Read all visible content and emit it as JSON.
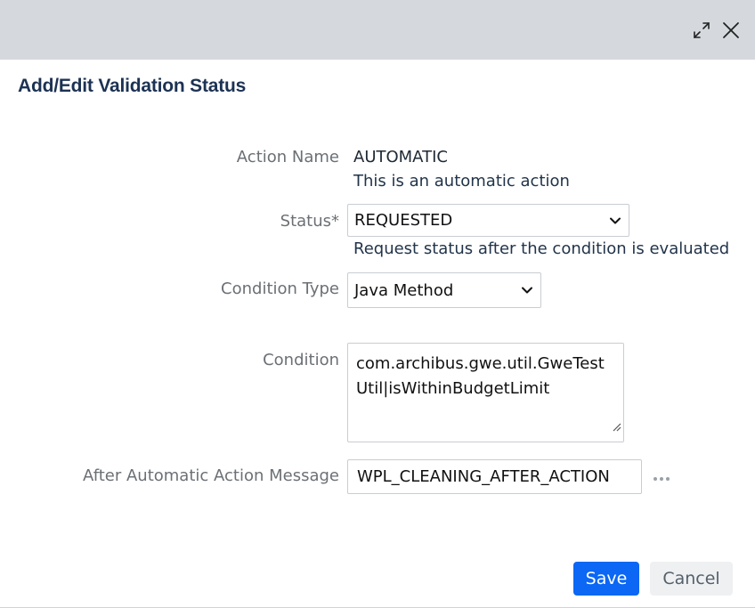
{
  "dialog": {
    "title": "Add/Edit Validation Status"
  },
  "form": {
    "action_name": {
      "label": "Action Name",
      "value": "AUTOMATIC",
      "description": "This is an automatic action"
    },
    "status": {
      "label": "Status*",
      "value": "REQUESTED",
      "hint": "Request status after the condition is evaluated"
    },
    "condition_type": {
      "label": "Condition Type",
      "value": "Java Method"
    },
    "condition": {
      "label": "Condition",
      "value": "com.archibus.gwe.util.GweTestUtil|isWithinBudgetLimit"
    },
    "after_message": {
      "label": "After Automatic Action Message",
      "value": "WPL_CLEANING_AFTER_ACTION"
    }
  },
  "buttons": {
    "save": "Save",
    "cancel": "Cancel"
  },
  "colors": {
    "titlebar_bg": "#d5d9dd",
    "primary": "#0b67f4",
    "title_text": "#1c3253"
  },
  "icons": {
    "expand": "expand-icon",
    "close": "close-icon",
    "dropdown": "chevron-down-icon",
    "more": "ellipsis-icon"
  }
}
